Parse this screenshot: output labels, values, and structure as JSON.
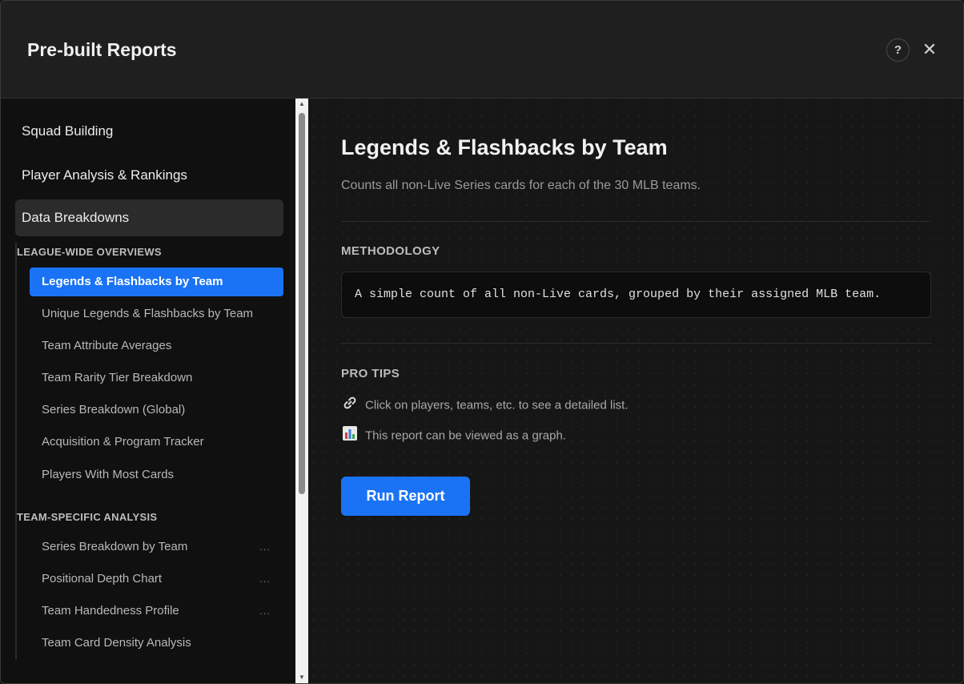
{
  "header": {
    "title": "Pre-built Reports",
    "help_label": "?",
    "close_label": "✕"
  },
  "sidebar": {
    "categories": [
      {
        "label": "Squad Building"
      },
      {
        "label": "Player Analysis & Rankings"
      },
      {
        "label": "Data Breakdowns"
      }
    ],
    "sections": [
      {
        "label": "LEAGUE-WIDE OVERVIEWS",
        "items": [
          {
            "label": "Legends & Flashbacks by Team"
          },
          {
            "label": "Unique Legends & Flashbacks by Team"
          },
          {
            "label": "Team Attribute Averages"
          },
          {
            "label": "Team Rarity Tier Breakdown"
          },
          {
            "label": "Series Breakdown (Global)"
          },
          {
            "label": "Acquisition & Program Tracker"
          },
          {
            "label": "Players With Most Cards"
          }
        ]
      },
      {
        "label": "TEAM-SPECIFIC ANALYSIS",
        "items": [
          {
            "label": "Series Breakdown by Team",
            "more": "..."
          },
          {
            "label": "Positional Depth Chart",
            "more": "..."
          },
          {
            "label": "Team Handedness Profile",
            "more": "..."
          },
          {
            "label": "Team Card Density Analysis"
          }
        ]
      }
    ]
  },
  "report": {
    "title": "Legends & Flashbacks by Team",
    "description": "Counts all non-Live Series cards for each of the 30 MLB teams.",
    "methodology_heading": "METHODOLOGY",
    "methodology_text": "A simple count of all non-Live cards, grouped by their assigned MLB team.",
    "tips_heading": "PRO TIPS",
    "tips": [
      {
        "icon": "link-icon",
        "text": "Click on players, teams, etc. to see a detailed list."
      },
      {
        "icon": "bar-chart-icon",
        "text": "This report can be viewed as a graph."
      }
    ],
    "run_label": "Run Report"
  },
  "colors": {
    "accent": "#1a73f5",
    "background": "#161616",
    "sidebar": "#101010"
  }
}
